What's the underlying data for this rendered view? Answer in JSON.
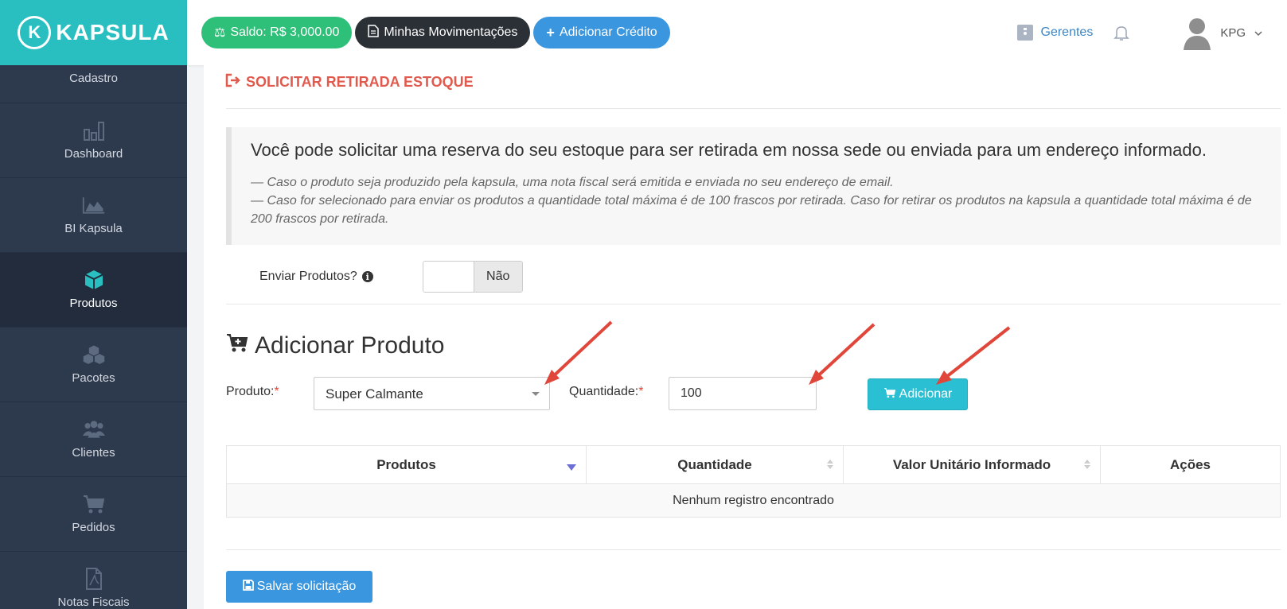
{
  "brand": {
    "name": "KAPSULA"
  },
  "sidebar": {
    "items": [
      {
        "label": "Cadastro",
        "icon": "user-icon"
      },
      {
        "label": "Dashboard",
        "icon": "bar-chart-icon"
      },
      {
        "label": "BI Kapsula",
        "icon": "area-chart-icon"
      },
      {
        "label": "Produtos",
        "icon": "cube-icon",
        "active": true
      },
      {
        "label": "Pacotes",
        "icon": "cubes-icon"
      },
      {
        "label": "Clientes",
        "icon": "users-icon"
      },
      {
        "label": "Pedidos",
        "icon": "cart-icon"
      },
      {
        "label": "Notas Fiscais",
        "icon": "file-pdf-icon"
      }
    ]
  },
  "topbar": {
    "saldo": "Saldo: R$ 3,000.00",
    "movimentacoes": "Minhas Movimentações",
    "adicionar_credito": "Adicionar Crédito",
    "gerentes": "Gerentes",
    "user": "KPG"
  },
  "page": {
    "title": "SOLICITAR RETIRADA ESTOQUE",
    "lead": "Você pode solicitar uma reserva do seu estoque para ser retirada em nossa sede ou enviada para um endereço informado.",
    "note1": "— Caso o produto seja produzido pela kapsula, uma nota fiscal será emitida e enviada no seu endereço de email.",
    "note2": "— Caso for selecionado para enviar os produtos a quantidade total máxima é de 100 frascos por retirada. Caso for retirar os produtos na kapsula a quantidade total máxima é de 200 frascos por retirada.",
    "enviar_label": "Enviar Produtos?",
    "toggle_off": "Não"
  },
  "add_section": {
    "title": "Adicionar Produto",
    "produto_label": "Produto:",
    "produto_value": "Super Calmante",
    "quantidade_label": "Quantidade:",
    "quantidade_value": "100",
    "add_button": "Adicionar"
  },
  "table": {
    "headers": [
      "Produtos",
      "Quantidade",
      "Valor Unitário Informado",
      "Ações"
    ],
    "empty": "Nenhum registro encontrado"
  },
  "footer": {
    "save_button": "Salvar solicitação"
  },
  "colors": {
    "brand": "#29bfc0",
    "sidebar": "#2d3a4e",
    "title": "#e05a4e",
    "accent_blue": "#3a96de",
    "arrow": "#e0473a"
  }
}
